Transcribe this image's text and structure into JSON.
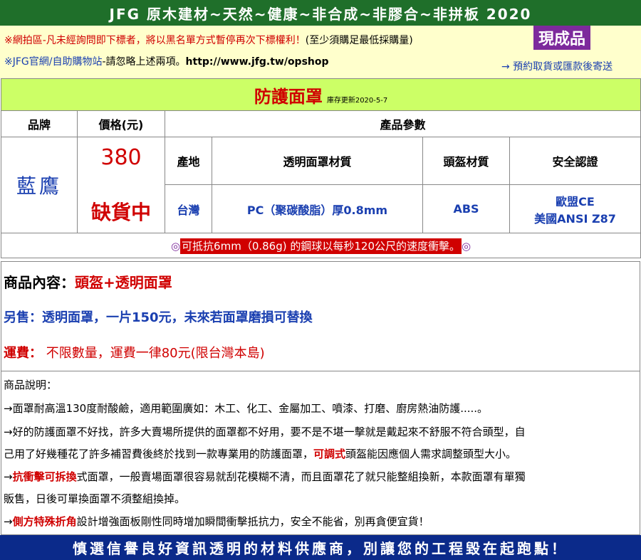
{
  "header": {
    "banner": "JFG 原木建材~天然~健康~非合成~非膠合~非拼板 2020"
  },
  "notice": {
    "line1_prefix": "※",
    "line1_red": "網拍區-凡未經詢問即下標者，將以黑名單方式暫停再次下標權利！",
    "line1_rest": "(至少須購足最低採購量)",
    "line2_prefix": "※",
    "line2_blue": "JFG官網/自助購物站",
    "line2_rest": "-請忽略上述兩項。",
    "line2_url": "http://www.jfg.tw/opshop",
    "badge": "現成品",
    "shipping_note": "→ 預約取貨或匯款後寄送"
  },
  "product": {
    "title": "防護面罩",
    "stock_update": "庫存更新2020-5-7",
    "col_brand": "品牌",
    "col_price": "價格(元)",
    "col_params": "產品參數",
    "brand": "藍鷹",
    "price": "380",
    "status": "缺貨中",
    "param_headers": [
      "產地",
      "透明面罩材質",
      "頭盔材質",
      "安全認證"
    ],
    "origin": "台灣",
    "shield_material": "PC（聚碳酸脂）厚0.8mm",
    "helmet_material": "ABS",
    "cert_line1": "歐盟CE",
    "cert_line2": "美國ANSI Z87",
    "impact_mark": "◎",
    "impact_text": "可抵抗6mm（0.86g) 的鋼球以每秒120公尺的速度衝擊。"
  },
  "content": {
    "items_label": "商品內容：",
    "items_value": "頭盔+透明面罩",
    "extra": "另售：透明面罩，一片150元，未來若面罩磨損可替換",
    "shipping_label": "運費：",
    "shipping_value": " 不限數量，運費一律80元(限台灣本島)"
  },
  "description": {
    "heading": "商品說明：",
    "line1": "→面罩耐高溫130度耐酸鹼，適用範圍廣如：木工、化工、金屬加工、噴漆、打磨、廚房熱油防護.....。",
    "line2": "→好的防護面罩不好找，許多大賣場所提供的面罩都不好用，要不是不堪一擊就是戴起來不舒服不符合頭型，自",
    "line3_a": "己用了好幾種花了許多補習費後終於找到一款專業用的防護面罩，",
    "line3_red": "可調式",
    "line3_b": "頭盔能因應個人需求調整頭型大小。",
    "line4_arrow": "→",
    "line4_red": "抗衝擊可拆換",
    "line4_b": "式面罩，一般賣場面罩很容易就刮花模糊不清，而且面罩花了就只能整組換新，本款面罩有單獨",
    "line5": "販售，日後可單換面罩不須整組換掉。",
    "line6_arrow": "→",
    "line6_red": "側方特殊折角",
    "line6_b": "設計增強面板剛性同時增加瞬間衝擊抵抗力，安全不能省，別再貪便宜貨！"
  },
  "footer": {
    "slogan": "慎選信譽良好資訊透明的材料供應商，別讓您的工程毀在起跑點！"
  },
  "colors": {
    "banner": "#1f6f2a",
    "title_bg": "#ccff66",
    "accent_red": "#d00000",
    "link_blue": "#1a3fb0",
    "badge": "#7d2a9c",
    "footer": "#0b2a8a"
  }
}
